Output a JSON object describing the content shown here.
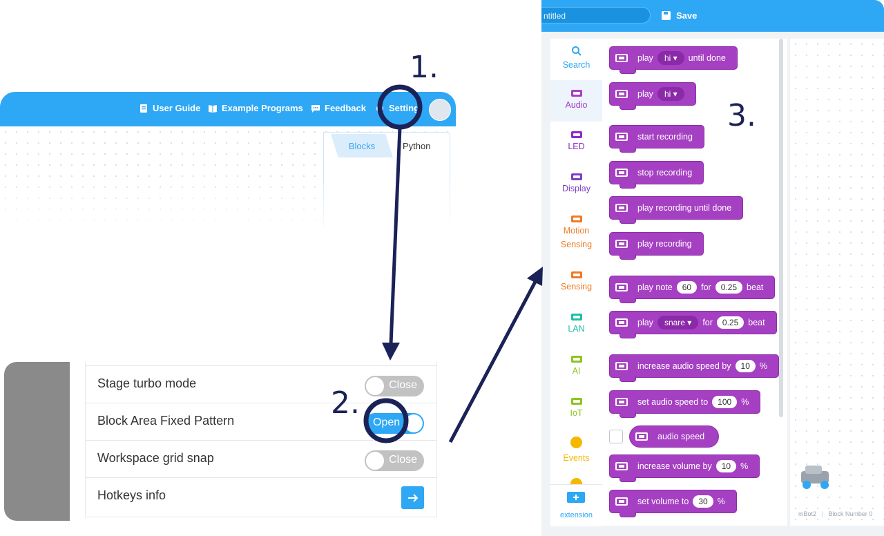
{
  "step_labels": [
    "1.",
    "2.",
    "3."
  ],
  "panel1": {
    "nav": [
      {
        "label": "User Guide",
        "icon": "book-icon"
      },
      {
        "label": "Example Programs",
        "icon": "open-book-icon"
      },
      {
        "label": "Feedback",
        "icon": "chat-icon"
      },
      {
        "label": "Setting",
        "icon": "gear-icon"
      }
    ],
    "tabs": {
      "blocks": "Blocks",
      "python": "Python"
    }
  },
  "panel2": {
    "rows": [
      {
        "label": "Stage turbo mode",
        "toggle": "Close",
        "state": "off"
      },
      {
        "label": "Block Area Fixed Pattern",
        "toggle": "Open",
        "state": "on"
      },
      {
        "label": "Workspace grid snap",
        "toggle": "Close",
        "state": "off"
      },
      {
        "label": "Hotkeys info",
        "action": "arrow-right-icon"
      }
    ]
  },
  "panel3": {
    "title": "ntitled",
    "save_label": "Save",
    "categories": [
      {
        "label": "Search",
        "color": "#2ea7f5"
      },
      {
        "label": "Audio",
        "color": "#a540c2"
      },
      {
        "label": "LED",
        "color": "#8c2bc9"
      },
      {
        "label": "Display",
        "color": "#7d3ec2"
      },
      {
        "label": "Motion Sensing",
        "color": "#f07a22"
      },
      {
        "label": "Sensing",
        "color": "#f07a22"
      },
      {
        "label": "LAN",
        "color": "#1bbfa7"
      },
      {
        "label": "AI",
        "color": "#8fc31f"
      },
      {
        "label": "IoT",
        "color": "#8fc31f"
      },
      {
        "label": "Events",
        "color": "#f5b700"
      }
    ],
    "extension_label": "extension",
    "blocks": {
      "b1": {
        "text": "play",
        "dd": "hi ▾",
        "text2": "until done"
      },
      "b2": {
        "text": "play",
        "dd": "hi ▾"
      },
      "b3": {
        "text": "start recording"
      },
      "b4": {
        "text": "stop recording"
      },
      "b5": {
        "text": "play recording until done"
      },
      "b6": {
        "text": "play recording"
      },
      "b7": {
        "text": "play note",
        "v1": "60",
        "text2": "for",
        "v2": "0.25",
        "text3": "beat"
      },
      "b8": {
        "text": "play",
        "dd": "snare ▾",
        "text2": "for",
        "v2": "0.25",
        "text3": "beat"
      },
      "b9": {
        "text": "increase audio speed by",
        "v1": "10",
        "text2": "%"
      },
      "b10": {
        "text": "set audio speed to",
        "v1": "100",
        "text2": "%"
      },
      "b11": {
        "text": "audio speed"
      },
      "b12": {
        "text": "increase volume by",
        "v1": "10",
        "text2": "%"
      },
      "b13": {
        "text": "set volume to",
        "v1": "30",
        "text2": "%"
      }
    },
    "stage": {
      "device": "mBot2",
      "block_number": "Block Number 0"
    }
  }
}
